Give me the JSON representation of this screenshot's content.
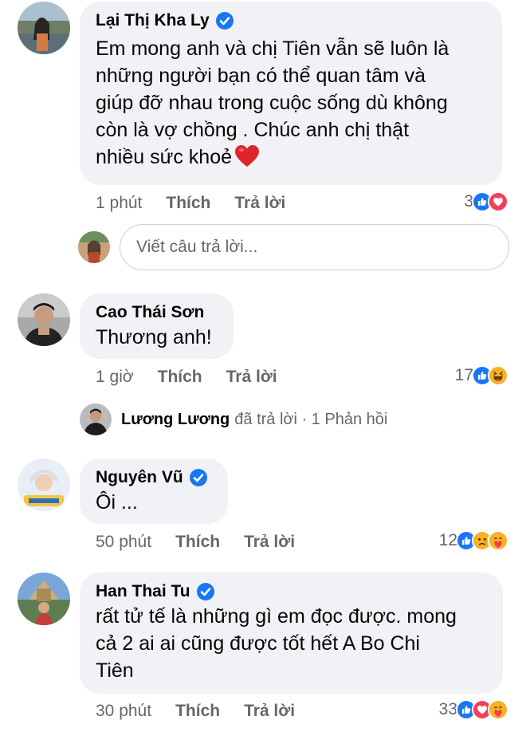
{
  "reply_input": {
    "placeholder": "Viết câu trả lời..."
  },
  "comments": [
    {
      "author": "Lại Thị Kha Ly",
      "verified": true,
      "lines": [
        "Em mong anh và chị Tiên vẫn sẽ luôn là",
        "những người bạn có thể quan tâm và",
        "giúp đỡ nhau trong cuộc sống dù không",
        "còn là vợ chồng . Chúc anh chị thật",
        "nhiều sức khoẻ"
      ],
      "emoji": "red-heart",
      "time": "1 phút",
      "like_label": "Thích",
      "reply_label": "Trả lời",
      "reaction_count": "3",
      "reactions": [
        "like-reaction",
        "love-reaction"
      ]
    },
    {
      "author": "Cao Thái Sơn",
      "verified": false,
      "lines": [
        "Thương anh!"
      ],
      "time": "1 giờ",
      "like_label": "Thích",
      "reply_label": "Trả lời",
      "reaction_count": "17",
      "reactions": [
        "like-reaction",
        "haha-reaction"
      ],
      "replies": {
        "author": "Lương Lương",
        "text": "đã trả lời · 1 Phản hồi"
      }
    },
    {
      "author": "Nguyên Vũ",
      "verified": true,
      "lines": [
        "Ôi ..."
      ],
      "time": "50 phút",
      "like_label": "Thích",
      "reply_label": "Trả lời",
      "reaction_count": "12",
      "reactions": [
        "like-reaction",
        "sad-reaction",
        "care-reaction"
      ]
    },
    {
      "author": "Han Thai Tu",
      "verified": true,
      "lines": [
        "rất tử tế là những gì em đọc được. mong",
        "cả 2 ai ai cũng được tốt hết A Bo Chi",
        "Tiên"
      ],
      "time": "30 phút",
      "like_label": "Thích",
      "reply_label": "Trả lời",
      "reaction_count": "33",
      "reactions": [
        "like-reaction",
        "love-reaction",
        "care-reaction"
      ]
    }
  ],
  "colors": {
    "bubble": "#f0f2f5",
    "meta_text": "#65676b",
    "facebook_blue": "#1877f2",
    "love_red": "#f33e58",
    "emoji_yellow": "#f7b125"
  }
}
